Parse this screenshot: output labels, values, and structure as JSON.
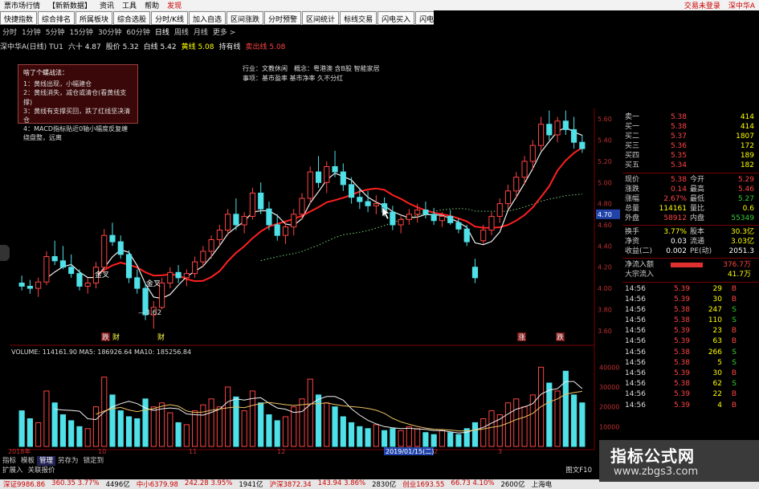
{
  "topbar": {
    "left_items": [
      "票市场行情",
      "【新新数据】",
      "资讯",
      "工具",
      "帮助",
      "发现"
    ],
    "right_items": [
      "交易未登录",
      "深中华A"
    ]
  },
  "toolbar": {
    "buttons": [
      "快捷指数",
      "综合排名",
      "所属板块",
      "综合选股",
      "分时/K线",
      "加入自选",
      "区间涨跌",
      "分时预警",
      "区间统计",
      "标线交易",
      "闪电买入",
      "闪电卖出"
    ]
  },
  "periods": {
    "items": [
      "分时",
      "1分钟",
      "5分钟",
      "15分钟",
      "30分钟",
      "60分钟",
      "日线",
      "周线",
      "月线",
      "更多 >"
    ],
    "active": "日线"
  },
  "info_line": {
    "title": "深中华A(日线) TU1",
    "items": [
      {
        "text": "六十 4.87",
        "color": "#e8e8e8"
      },
      {
        "text": "股价 5.32",
        "color": "#e8e8e8"
      },
      {
        "text": "白线 5.42",
        "color": "#f0f0f0"
      },
      {
        "text": "黄线 5.08",
        "color": "#ffff00"
      },
      {
        "text": "持有线",
        "color": "#e8e8e8"
      },
      {
        "text": "卖出线 5.08",
        "color": "#ff4444"
      }
    ]
  },
  "info_box": {
    "title": "啥了个螺战法：",
    "lines": [
      "1：黄线出现，小幅建仓",
      "2：黄线消失，减仓或清仓(看黄线支撑)",
      "3：黄线有支撑买回，跌了红线坚决清仓",
      "4：MACD指标贴近0轴小幅度反复缠绕盘整，远离"
    ]
  },
  "industry": {
    "line1": "行业：文教休闲　概念：粤港澳 含B股 智能家居",
    "line2": "事项：基市盈率 基市净率 久不分红"
  },
  "chart_labels": {
    "jincha1": "金叉",
    "jincha2": "金叉",
    "low_price": "3.62",
    "cai1": "财",
    "cai2": "财",
    "marker_left": "跌",
    "marker_right1": "涨",
    "marker_right2": "跌"
  },
  "volume_header": "VOLUME: 114161.90  MA5: 186926.64  MA10: 185256.84",
  "price_axis": [
    "5.60",
    "5.40",
    "5.20",
    "5.00",
    "4.80",
    "4.70",
    "4.60",
    "4.40",
    "4.20",
    "4.00",
    "3.80",
    "3.60"
  ],
  "volume_axis": [
    "40000",
    "30000",
    "20000",
    "10000"
  ],
  "date_axis": [
    "2018年",
    "10",
    "11",
    "12",
    "2019/01/15(二)",
    "2",
    "3"
  ],
  "chart_data": {
    "type": "candlestick",
    "title": "深中华A(日线)",
    "ylim": [
      3.5,
      5.7
    ],
    "candles": [
      [
        4.05,
        4.12,
        3.98,
        4.02
      ],
      [
        4.02,
        4.08,
        3.95,
        4.0
      ],
      [
        4.0,
        4.1,
        3.92,
        4.06
      ],
      [
        4.06,
        4.35,
        4.03,
        4.3
      ],
      [
        4.3,
        4.45,
        4.22,
        4.26
      ],
      [
        4.26,
        4.4,
        4.18,
        4.2
      ],
      [
        4.2,
        4.32,
        4.1,
        4.14
      ],
      [
        4.14,
        4.18,
        3.98,
        4.02
      ],
      [
        4.02,
        4.1,
        3.95,
        4.05
      ],
      [
        4.05,
        4.25,
        4.0,
        4.2
      ],
      [
        4.2,
        4.56,
        4.18,
        4.5
      ],
      [
        4.5,
        4.62,
        4.4,
        4.44
      ],
      [
        4.44,
        4.5,
        4.28,
        4.32
      ],
      [
        4.32,
        4.36,
        4.05,
        4.1
      ],
      [
        4.1,
        4.18,
        3.95,
        4.0
      ],
      [
        4.0,
        4.05,
        3.7,
        3.75
      ],
      [
        3.75,
        3.88,
        3.62,
        3.82
      ],
      [
        3.82,
        4.1,
        3.8,
        4.05
      ],
      [
        4.05,
        4.2,
        4.0,
        4.15
      ],
      [
        4.15,
        4.22,
        4.05,
        4.1
      ],
      [
        4.1,
        4.18,
        4.02,
        4.14
      ],
      [
        4.14,
        4.3,
        4.1,
        4.25
      ],
      [
        4.25,
        4.4,
        4.2,
        4.35
      ],
      [
        4.35,
        4.5,
        4.28,
        4.46
      ],
      [
        4.46,
        4.6,
        4.4,
        4.55
      ],
      [
        4.55,
        4.75,
        4.5,
        4.7
      ],
      [
        4.7,
        4.85,
        4.55,
        4.6
      ],
      [
        4.6,
        4.72,
        4.52,
        4.68
      ],
      [
        4.68,
        4.95,
        4.65,
        4.9
      ],
      [
        4.9,
        5.0,
        4.7,
        4.75
      ],
      [
        4.75,
        4.82,
        4.55,
        4.6
      ],
      [
        4.6,
        4.7,
        4.45,
        4.5
      ],
      [
        4.5,
        4.62,
        4.42,
        4.58
      ],
      [
        4.58,
        4.75,
        4.5,
        4.7
      ],
      [
        4.7,
        4.9,
        4.65,
        4.85
      ],
      [
        4.85,
        5.15,
        4.8,
        5.1
      ],
      [
        5.1,
        5.25,
        4.95,
        5.0
      ],
      [
        5.0,
        5.2,
        4.9,
        5.15
      ],
      [
        5.15,
        5.3,
        5.05,
        5.1
      ],
      [
        5.1,
        5.18,
        4.92,
        4.98
      ],
      [
        4.98,
        5.05,
        4.8,
        4.86
      ],
      [
        4.86,
        4.95,
        4.75,
        4.82
      ],
      [
        4.82,
        4.92,
        4.72,
        4.78
      ],
      [
        4.78,
        4.88,
        4.7,
        4.8
      ],
      [
        4.8,
        4.86,
        4.68,
        4.72
      ],
      [
        4.72,
        4.78,
        4.55,
        4.6
      ],
      [
        4.6,
        4.68,
        4.52,
        4.65
      ],
      [
        4.65,
        4.75,
        4.6,
        4.7
      ],
      [
        4.7,
        4.8,
        4.62,
        4.74
      ],
      [
        4.74,
        4.82,
        4.66,
        4.7
      ],
      [
        4.7,
        4.76,
        4.6,
        4.64
      ],
      [
        4.64,
        4.72,
        4.58,
        4.68
      ],
      [
        4.68,
        4.74,
        4.6,
        4.62
      ],
      [
        4.62,
        4.66,
        4.52,
        4.56
      ],
      [
        4.56,
        4.6,
        4.4,
        4.44
      ],
      [
        4.2,
        4.28,
        4.05,
        4.1
      ],
      [
        4.45,
        4.6,
        4.42,
        4.55
      ],
      [
        4.55,
        4.72,
        4.5,
        4.68
      ],
      [
        4.68,
        4.85,
        4.62,
        4.8
      ],
      [
        4.8,
        4.98,
        4.75,
        4.92
      ],
      [
        4.92,
        5.1,
        4.85,
        5.05
      ],
      [
        5.05,
        5.25,
        4.98,
        5.2
      ],
      [
        5.2,
        5.4,
        5.12,
        5.35
      ],
      [
        5.35,
        5.62,
        5.3,
        5.55
      ],
      [
        5.55,
        5.68,
        5.4,
        5.45
      ],
      [
        5.45,
        5.62,
        5.38,
        5.58
      ],
      [
        5.58,
        5.68,
        5.45,
        5.5
      ],
      [
        5.5,
        5.62,
        5.32,
        5.38
      ],
      [
        5.38,
        5.45,
        5.28,
        5.32
      ]
    ],
    "volume": [
      18000,
      14000,
      12000,
      28000,
      22000,
      16000,
      13000,
      10000,
      9000,
      20000,
      35000,
      26000,
      18000,
      15000,
      14000,
      24000,
      20000,
      22000,
      17000,
      12000,
      11000,
      18000,
      21000,
      24000,
      20000,
      30000,
      25000,
      18000,
      28000,
      22000,
      16000,
      13000,
      15000,
      20000,
      24000,
      34000,
      26000,
      22000,
      20000,
      15000,
      12000,
      10000,
      9000,
      11000,
      8000,
      9000,
      8000,
      10000,
      9000,
      7000,
      6000,
      8000,
      7000,
      6000,
      9000,
      12000,
      14000,
      18000,
      16000,
      22000,
      24000,
      20000,
      26000,
      40000,
      32000,
      28000,
      38000,
      26000,
      22000
    ],
    "ma_volume_5": 186926.64,
    "ma_volume_10": 185256.84
  },
  "quote_panel": {
    "rows": [
      {
        "label": "卖一",
        "value": "5.38",
        "color": "#ff4444",
        "extra": "414"
      },
      {
        "label": "买一",
        "value": "5.38",
        "color": "#ff4444",
        "extra": "414"
      },
      {
        "label": "买二",
        "value": "5.37",
        "color": "#ff4444",
        "extra": "1807"
      },
      {
        "label": "买三",
        "value": "5.36",
        "color": "#ff4444",
        "extra": "172"
      },
      {
        "label": "买四",
        "value": "5.35",
        "color": "#ff4444",
        "extra": "189"
      },
      {
        "label": "买五",
        "value": "5.34",
        "color": "#ff4444",
        "extra": "182"
      }
    ],
    "stats": [
      {
        "l1": "现价",
        "v1": "5.38",
        "c1": "#ff4444",
        "l2": "今开",
        "v2": "5.29",
        "c2": "#ff4444"
      },
      {
        "l1": "涨跌",
        "v1": "0.14",
        "c1": "#ff4444",
        "l2": "最高",
        "v2": "5.46",
        "c2": "#ff4444"
      },
      {
        "l1": "涨幅",
        "v1": "2.67%",
        "c1": "#ff4444",
        "l2": "最低",
        "v2": "5.27",
        "c2": "#33cc33"
      },
      {
        "l1": "总量",
        "v1": "114161",
        "c1": "#ffff00",
        "l2": "量比",
        "v2": "0.6",
        "c2": "#ffff00"
      },
      {
        "l1": "外盘",
        "v1": "58912",
        "c1": "#ff4444",
        "l2": "内盘",
        "v2": "55349",
        "c2": "#33cc33"
      }
    ],
    "finance": [
      {
        "l1": "换手",
        "v1": "3.77%",
        "c1": "#ffff00",
        "l2": "股本",
        "v2": "30.3亿",
        "c2": "#ffff00"
      },
      {
        "l1": "净资",
        "v1": "0.03",
        "c1": "#ffffff",
        "l2": "流通",
        "v2": "3.03亿",
        "c2": "#ffff00"
      },
      {
        "l1": "收益(二)",
        "v1": "0.002",
        "c1": "#ffffff",
        "l2": "PE(动)",
        "v2": "2051.3",
        "c2": "#ffffff"
      }
    ],
    "flow": [
      {
        "label": "净流入额",
        "value": "376.7万",
        "color": "#ff4444"
      },
      {
        "label": "大宗流入",
        "value": "41.7万",
        "color": "#ffff00"
      }
    ],
    "ticks": [
      {
        "t": "14:56",
        "p": "5.39",
        "v": "29",
        "s": "B",
        "sc": "#ff4444"
      },
      {
        "t": "14:56",
        "p": "5.39",
        "v": "30",
        "s": "B",
        "sc": "#ff4444"
      },
      {
        "t": "14:56",
        "p": "5.38",
        "v": "247",
        "s": "S",
        "sc": "#33cc33"
      },
      {
        "t": "14:56",
        "p": "5.38",
        "v": "110",
        "s": "S",
        "sc": "#33cc33"
      },
      {
        "t": "14:56",
        "p": "5.39",
        "v": "23",
        "s": "B",
        "sc": "#ff4444"
      },
      {
        "t": "14:56",
        "p": "5.39",
        "v": "63",
        "s": "B",
        "sc": "#ff4444"
      },
      {
        "t": "14:56",
        "p": "5.38",
        "v": "266",
        "s": "S",
        "sc": "#33cc33"
      },
      {
        "t": "14:56",
        "p": "5.38",
        "v": "5",
        "s": "S",
        "sc": "#33cc33"
      },
      {
        "t": "14:56",
        "p": "5.39",
        "v": "30",
        "s": "B",
        "sc": "#ff4444"
      },
      {
        "t": "14:56",
        "p": "5.38",
        "v": "62",
        "s": "S",
        "sc": "#33cc33"
      },
      {
        "t": "14:56",
        "p": "5.39",
        "v": "22",
        "s": "B",
        "sc": "#ff4444"
      },
      {
        "t": "14:56",
        "p": "5.39",
        "v": "4",
        "s": "B",
        "sc": "#ff4444"
      }
    ]
  },
  "bottom_tabs": {
    "row1": [
      "指标",
      "模板",
      "管理",
      "另存为",
      "锁定到"
    ],
    "row2": [
      "扩展入",
      "关联报价"
    ],
    "right": "图文F10"
  },
  "statusbar": [
    {
      "text": "深证9986.86",
      "color": "#c00"
    },
    {
      "text": "360.35 3.77%",
      "color": "#c00"
    },
    {
      "text": "4496亿",
      "color": "#000"
    },
    {
      "text": "中小6379.98",
      "color": "#c00"
    },
    {
      "text": "242.28 3.95%",
      "color": "#c00"
    },
    {
      "text": "1941亿",
      "color": "#000"
    },
    {
      "text": "沪深3872.34",
      "color": "#c00"
    },
    {
      "text": "143.94 3.86%",
      "color": "#c00"
    },
    {
      "text": "2830亿",
      "color": "#000"
    },
    {
      "text": "创业1693.55",
      "color": "#c00"
    },
    {
      "text": "66.73 4.10%",
      "color": "#c00"
    },
    {
      "text": "2600亿",
      "color": "#000"
    },
    {
      "text": "上海电",
      "color": "#000"
    }
  ],
  "watermark": {
    "title": "指标公式网",
    "url": "www.zbgs3.com"
  },
  "colors": {
    "up": "#ff4444",
    "down": "#4fe0e8",
    "ma_white": "#f0f0f0",
    "ma_red": "#ff2020",
    "ma_dotted": "#7acf7a"
  }
}
